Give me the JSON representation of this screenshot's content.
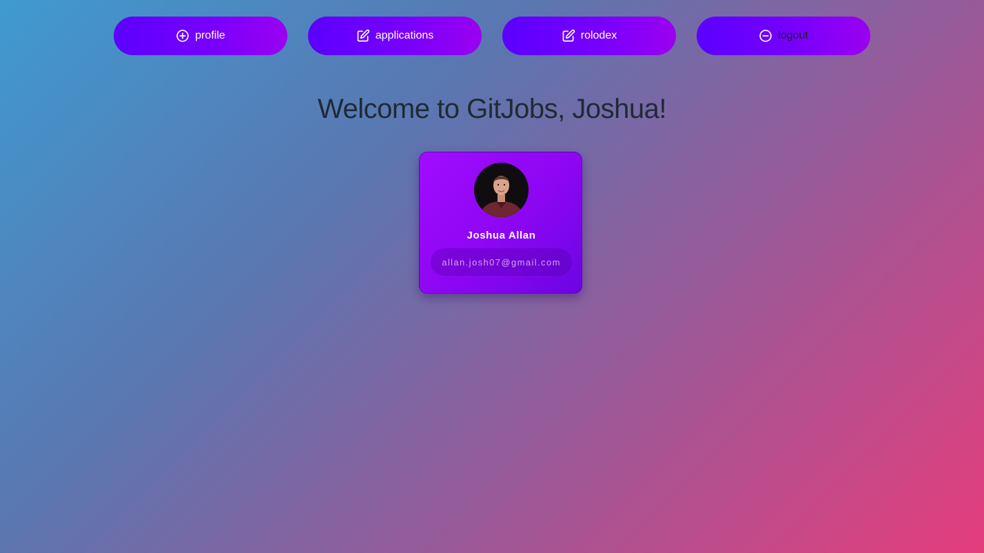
{
  "nav": {
    "profile": {
      "label": "profile",
      "icon": "plus-circle-icon"
    },
    "applications": {
      "label": "applications",
      "icon": "edit-icon"
    },
    "rolodex": {
      "label": "rolodex",
      "icon": "edit-icon"
    },
    "logout": {
      "label": "logout",
      "icon": "minus-circle-icon"
    }
  },
  "welcome": "Welcome to GitJobs, Joshua!",
  "profile_card": {
    "name": "Joshua Allan",
    "email": "allan.josh07@gmail.com"
  },
  "colors": {
    "button_gradient_start": "#5b00ff",
    "button_gradient_end": "#9b00f0",
    "background_start": "#3f9ad0",
    "background_end": "#e53d7c",
    "card_start": "#a10cff",
    "card_end": "#6b05e3"
  }
}
